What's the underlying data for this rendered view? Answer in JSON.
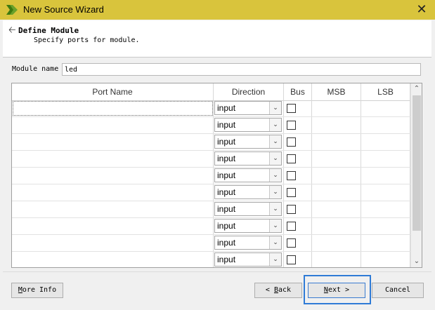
{
  "window": {
    "title": "New Source Wizard",
    "close_glyph": "✕",
    "colors": {
      "titlebar": "#d9c43c",
      "accent": "#2f7bd6"
    }
  },
  "header": {
    "back_icon": "back-arrow-icon",
    "title": "Define Module",
    "subtitle": "Specify ports for module."
  },
  "module": {
    "label": "Module name",
    "value": "led"
  },
  "table": {
    "columns": [
      "Port Name",
      "Direction",
      "Bus",
      "MSB",
      "LSB"
    ],
    "rows": [
      {
        "name": "",
        "direction": "input",
        "bus": false,
        "msb": "",
        "lsb": ""
      },
      {
        "name": "",
        "direction": "input",
        "bus": false,
        "msb": "",
        "lsb": ""
      },
      {
        "name": "",
        "direction": "input",
        "bus": false,
        "msb": "",
        "lsb": ""
      },
      {
        "name": "",
        "direction": "input",
        "bus": false,
        "msb": "",
        "lsb": ""
      },
      {
        "name": "",
        "direction": "input",
        "bus": false,
        "msb": "",
        "lsb": ""
      },
      {
        "name": "",
        "direction": "input",
        "bus": false,
        "msb": "",
        "lsb": ""
      },
      {
        "name": "",
        "direction": "input",
        "bus": false,
        "msb": "",
        "lsb": ""
      },
      {
        "name": "",
        "direction": "input",
        "bus": false,
        "msb": "",
        "lsb": ""
      },
      {
        "name": "",
        "direction": "input",
        "bus": false,
        "msb": "",
        "lsb": ""
      },
      {
        "name": "",
        "direction": "input",
        "bus": false,
        "msb": "",
        "lsb": ""
      }
    ]
  },
  "buttons": {
    "more_info": {
      "mnemonic": "M",
      "rest": "ore Info"
    },
    "back": {
      "prefix": "< ",
      "mnemonic": "B",
      "rest": "ack"
    },
    "next": {
      "mnemonic": "N",
      "rest": "ext >"
    },
    "cancel": "Cancel"
  }
}
